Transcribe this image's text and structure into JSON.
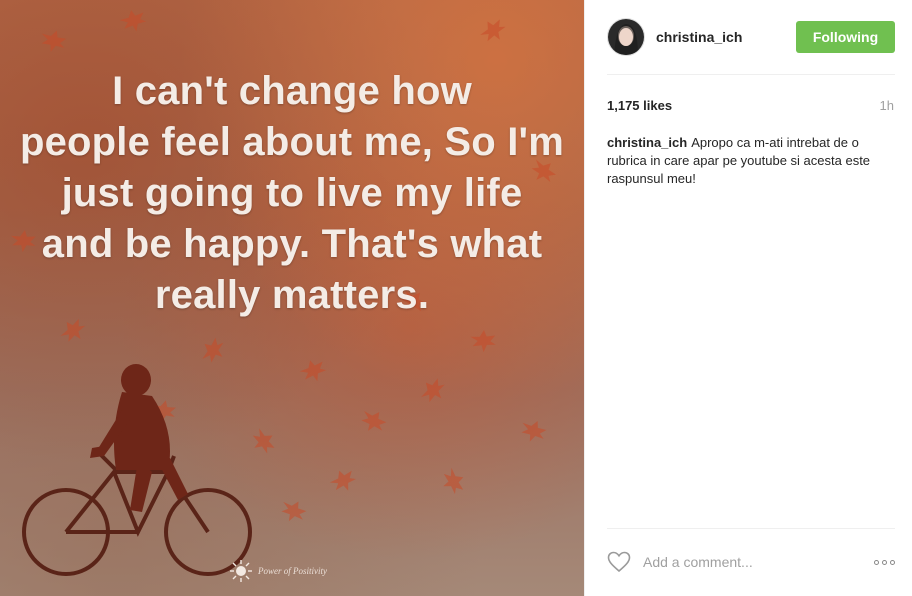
{
  "post": {
    "quote_lines": [
      "I can't change how",
      "people feel about me, So I'm",
      "just going to live my life",
      "and be happy. That's what",
      "really matters."
    ],
    "watermark": "Power of Positivity"
  },
  "header": {
    "username": "christina_ich",
    "follow_label": "Following"
  },
  "stats": {
    "likes": "1,175 likes",
    "time": "1h"
  },
  "caption": {
    "username": "christina_ich",
    "text": "Apropo ca m-ati intrebat de o rubrica in care apar pe youtube si acesta este raspunsul meu!"
  },
  "comment": {
    "placeholder": "Add a comment..."
  },
  "colors": {
    "follow_button": "#70c050",
    "text": "#262626",
    "muted": "#a0a0a0"
  }
}
